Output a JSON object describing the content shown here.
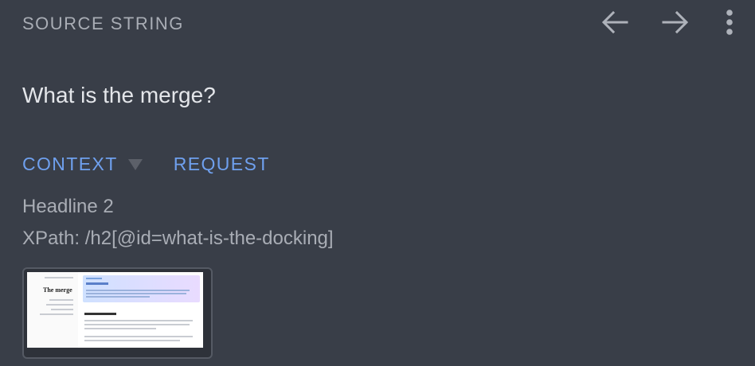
{
  "header": {
    "title": "SOURCE STRING"
  },
  "toolbar": {
    "icons": [
      "arrow-left-icon",
      "arrow-right-icon",
      "more-vertical-icon"
    ]
  },
  "source": {
    "text": "What is the merge?"
  },
  "tabs": [
    {
      "label": "CONTEXT",
      "active": true,
      "has_dropdown": true
    },
    {
      "label": "REQUEST",
      "active": false
    }
  ],
  "context": {
    "element_type": "Headline 2",
    "xpath": "XPath: /h2[@id=what-is-the-docking]"
  },
  "screenshot_thumbnail": {
    "heading": "The merge"
  },
  "colors": {
    "background": "#393e48",
    "accent": "#6fa0ee",
    "muted_text": "#a9adb5",
    "primary_text": "#e4e6ea"
  }
}
